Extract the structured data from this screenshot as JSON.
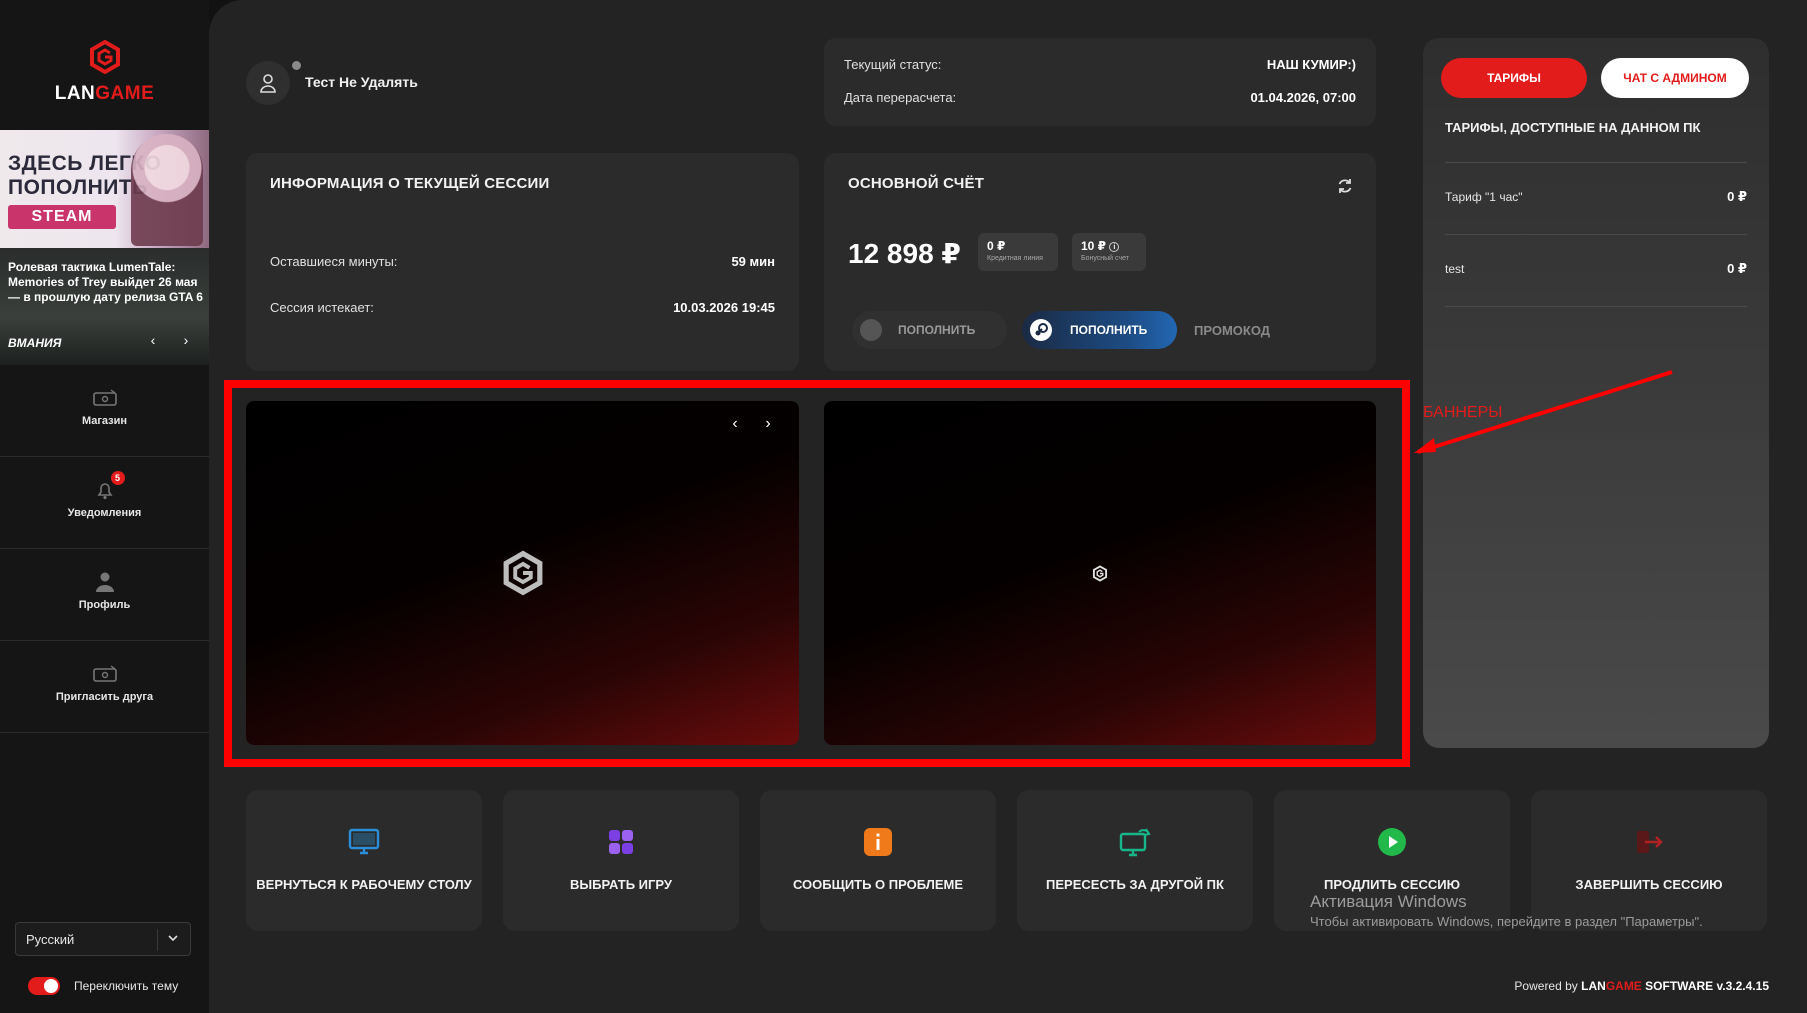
{
  "sidebar": {
    "logo": {
      "lan": "LAN",
      "game": "GAME"
    },
    "promo": {
      "headline_line1": "ЗДЕСЬ ЛЕГКО",
      "headline_line2": "ПОПОЛНИТЬ",
      "steam": "STEAM",
      "caption": "Ролевая тактика LumenTale: Memories of Trey выйдет 26 мая — в прошлую дату релиза GTA 6",
      "brand": "ВМАНИЯ"
    },
    "items": [
      {
        "label": "Магазин",
        "icon": "gift-card-icon"
      },
      {
        "label": "Уведомления",
        "icon": "bell-icon",
        "badge": "5"
      },
      {
        "label": "Профиль",
        "icon": "user-icon"
      },
      {
        "label": "Пригласить друга",
        "icon": "gift-card-icon"
      }
    ],
    "language": "Русский",
    "theme_label": "Переключить тему"
  },
  "user": {
    "name": "Тест Не Удалять"
  },
  "status": {
    "current_label": "Текущий статус:",
    "current_value": "НАШ КУМИР:)",
    "recalc_label": "Дата перерасчета:",
    "recalc_value": "01.04.2026, 07:00"
  },
  "session": {
    "title": "ИНФОРМАЦИЯ О ТЕКУЩЕЙ СЕССИИ",
    "remaining_label": "Оставшиеся минуты:",
    "remaining_value": "59 мин",
    "expires_label": "Сессия истекает:",
    "expires_value": "10.03.2026 19:45"
  },
  "account": {
    "title": "ОСНОВНОЙ СЧЁТ",
    "balance": "12 898 ₽",
    "credit_value": "0 ₽",
    "credit_label": "Кредитная линия",
    "bonus_value": "10 ₽",
    "bonus_label": "Бонусный счет",
    "topup_label": "ПОПОЛНИТЬ",
    "topup_steam_label": "ПОПОЛНИТЬ",
    "promo_label": "ПРОМОКОД"
  },
  "banners": {
    "annotation": "БАННЕРЫ"
  },
  "tariffs": {
    "tab_tariffs": "ТАРИФЫ",
    "tab_chat": "ЧАТ С АДМИНОМ",
    "title": "ТАРИФЫ, ДОСТУПНЫЕ НА ДАННОМ ПК",
    "rows": [
      {
        "name": "Тариф \"1 час\"",
        "price": "0 ₽"
      },
      {
        "name": "test",
        "price": "0 ₽"
      }
    ]
  },
  "actions": [
    {
      "label": "ВЕРНУТЬСЯ К РАБОЧЕМУ СТОЛУ",
      "icon": "monitor-icon",
      "color": "#2a8fd8"
    },
    {
      "label": "ВЫБРАТЬ ИГРУ",
      "icon": "grid-icon",
      "color": "#7b3fe4"
    },
    {
      "label": "СООБЩИТЬ О ПРОБЛЕМЕ",
      "icon": "info-icon",
      "color": "#f07a1a"
    },
    {
      "label": "ПЕРЕСЕСТЬ ЗА ДРУГОЙ ПК",
      "icon": "switch-pc-icon",
      "color": "#18b58a"
    },
    {
      "label": "ПРОДЛИТЬ СЕССИЮ",
      "icon": "play-icon",
      "color": "#22b94a"
    },
    {
      "label": "ЗАВЕРШИТЬ СЕССИЮ",
      "icon": "logout-icon",
      "color": "#7a1d1d"
    }
  ],
  "watermark": {
    "line1": "Активация Windows",
    "line2": "Чтобы активировать Windows, перейдите в раздел \"Параметры\"."
  },
  "footer": {
    "powered": "Powered by",
    "lan": "LAN",
    "game": "GAME",
    "software": "SOFTWARE",
    "version": "v.3.2.4.15"
  },
  "colors": {
    "accent": "#e21b1b",
    "background": "#232323",
    "card": "#2b2b2b"
  }
}
